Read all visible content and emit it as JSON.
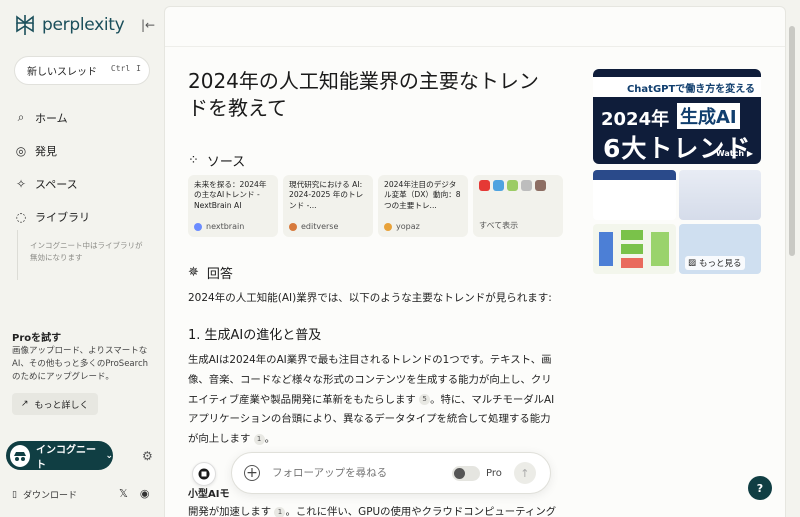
{
  "app": {
    "name": "perplexity"
  },
  "sidebar": {
    "new_thread": "新しいスレッド",
    "shortcut_keys": [
      "Ctrl",
      "I"
    ],
    "nav": [
      {
        "label": "ホーム",
        "icon": "search-icon"
      },
      {
        "label": "発見",
        "icon": "globe-icon"
      },
      {
        "label": "スペース",
        "icon": "spaces-icon"
      },
      {
        "label": "ライブラリ",
        "icon": "library-icon"
      }
    ],
    "library_note": "インコグニート中はライブラリが無効になります",
    "pro_title": "Proを試す",
    "pro_desc": "画像アップロード、よりスマートなAI、その他もっと多くのProSearchのためにアップグレード。",
    "learn_more": "もっと詳しく",
    "incognito": "インコグニート",
    "download": "ダウンロード"
  },
  "main": {
    "title": "2024年の人工知能業界の主要なトレンドを教えて",
    "sources_heading": "ソース",
    "sources": [
      {
        "title": "未来を探る：2024年の主なAIトレンド - NextBrain AI",
        "site": "nextbrain",
        "color": "#6b8cff"
      },
      {
        "title": "現代研究における AI: 2024-2025 年のトレンド -...",
        "site": "editverse",
        "color": "#d77a3c"
      },
      {
        "title": "2024年注目のデジタル変革（DX）動向：8つの主要トレ...",
        "site": "yopaz",
        "color": "#e8a23a"
      }
    ],
    "show_all": "すべて表示",
    "answer_heading": "回答",
    "answer_intro": "2024年の人工知能(AI)業界では、以下のような主要なトレンドが見られます:",
    "subheading": "1. 生成AIの進化と普及",
    "paragraph_a": "生成AIは2024年のAI業界で最も注目されるトレンドの1つです。テキスト、画像、音楽、コードなど様々な形式のコンテンツを生成する能力が向上し、クリエイティブ産業や製品開発に革新をもたらします",
    "cite_a": "5",
    "paragraph_b": "。特に、マルチモーダルAIアプリケーションの台頭により、異なるデータタイプを統合して処理する能力が向上します",
    "cite_b": "1",
    "paragraph_c": "。",
    "cut_heading": "小型AIモ",
    "cut_line_a": "開発が加速します",
    "cut_cite": "1",
    "cut_line_b": "。これに伴い、GPUの使用やクラウドコンピューティングコスト",
    "followup_placeholder": "フォローアップを尋ねる",
    "pro_toggle": "Pro",
    "more_images": "もっと見る"
  },
  "images": {
    "main_banner": "ChatGPTで働き方を変える",
    "main_year": "2024年",
    "main_gen": "生成AI",
    "main_big": "6大トレンド",
    "main_watch": "Watch ▶"
  },
  "help": "?"
}
